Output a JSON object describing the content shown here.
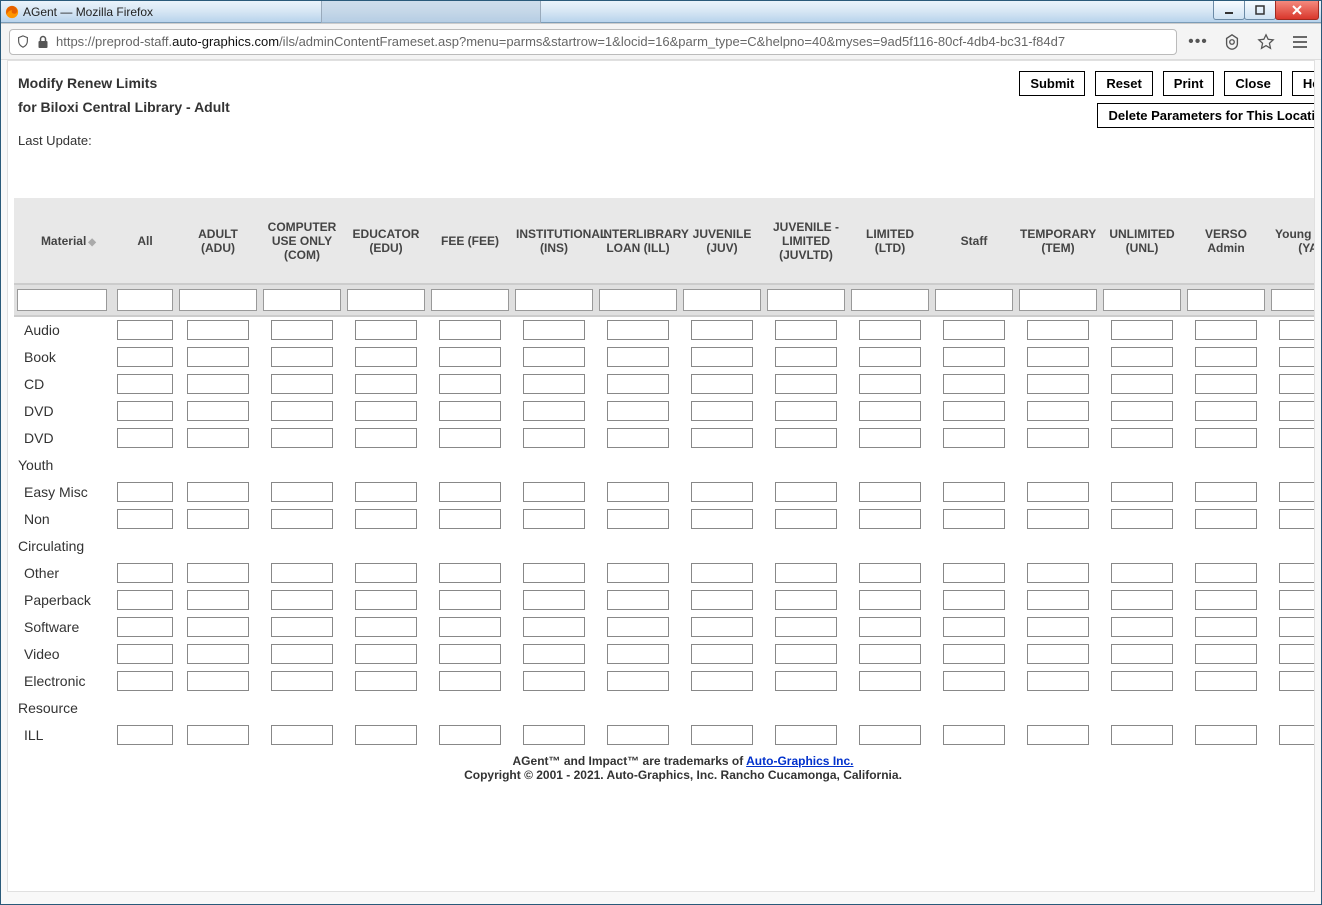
{
  "window": {
    "title": "AGent — Mozilla Firefox"
  },
  "browser": {
    "url_prefix": "https://preprod-staff.",
    "url_highlight": "auto-graphics.com",
    "url_suffix": "/ils/adminContentFrameset.asp?menu=parms&startrow=1&locid=16&parm_type=C&helpno=40&myses=9ad5f116-80cf-4db4-bc31-f84d7"
  },
  "page": {
    "title": "Modify Renew Limits",
    "subtitle": "for Biloxi Central Library - Adult",
    "last_update_label": "Last Update:",
    "buttons": {
      "submit": "Submit",
      "reset": "Reset",
      "print": "Print",
      "close": "Close",
      "help": "Help",
      "delete_params": "Delete Parameters for This Location"
    }
  },
  "table": {
    "columns": [
      "Material",
      "All",
      "ADULT (ADU)",
      "COMPUTER USE ONLY (COM)",
      "EDUCATOR (EDU)",
      "FEE (FEE)",
      "INSTITUTIONAL (INS)",
      "INTERLIBRARY LOAN (ILL)",
      "JUVENILE (JUV)",
      "JUVENILE - LIMITED (JUVLTD)",
      "LIMITED (LTD)",
      "Staff",
      "TEMPORARY (TEM)",
      "UNLIMITED (UNL)",
      "VERSO Admin",
      "Young Adult (YA)"
    ],
    "rows": [
      "Audio",
      "Book",
      "CD",
      "DVD",
      "DVD Youth",
      "Easy Misc",
      "Non Circulating",
      "Other",
      "Paperback",
      "Software",
      "Video",
      "Electronic Resource",
      "ILL"
    ]
  },
  "footer": {
    "line1a": "AGent™ and Impact™ are trademarks of ",
    "line1_link": "Auto-Graphics Inc.",
    "line2": "Copyright © 2001 - 2021. Auto-Graphics, Inc. Rancho Cucamonga, California."
  }
}
